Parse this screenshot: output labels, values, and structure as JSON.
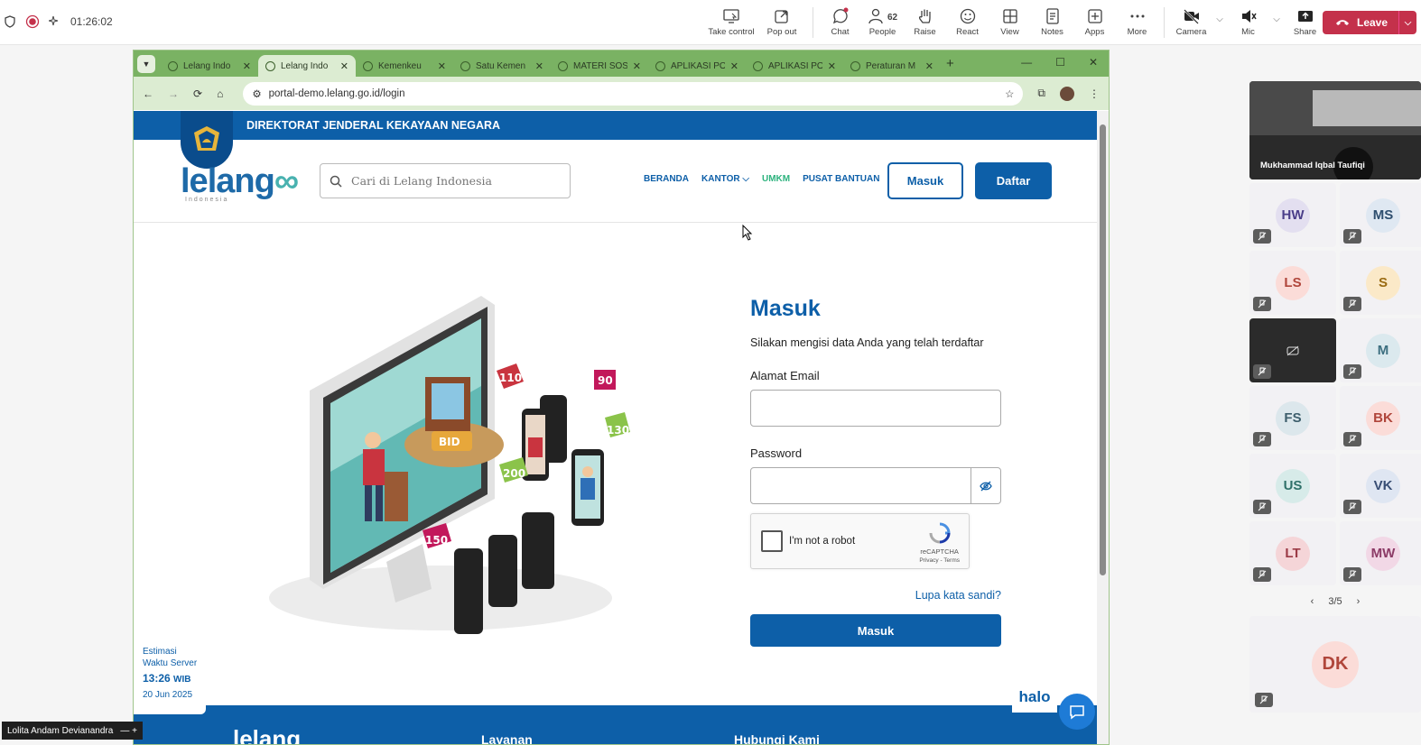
{
  "teams": {
    "timer": "01:26:02",
    "toolbar": [
      {
        "label": "Take control",
        "icon": "take-control-icon"
      },
      {
        "label": "Pop out",
        "icon": "pop-out-icon"
      },
      {
        "label": "Chat",
        "icon": "chat-icon"
      },
      {
        "label": "People",
        "icon": "people-icon",
        "count": "62"
      },
      {
        "label": "Raise",
        "icon": "raise-hand-icon"
      },
      {
        "label": "React",
        "icon": "react-icon"
      },
      {
        "label": "View",
        "icon": "view-icon"
      },
      {
        "label": "Notes",
        "icon": "notes-icon"
      },
      {
        "label": "Apps",
        "icon": "apps-icon"
      },
      {
        "label": "More",
        "icon": "more-icon"
      }
    ],
    "camera_label": "Camera",
    "mic_label": "Mic",
    "share_label": "Share",
    "leave_label": "Leave",
    "leave_color": "#c4314b",
    "presenter_name": "Lolita Andam Devianandra",
    "gallery": {
      "video_name": "Mukhammad Iqbal Taufiqi",
      "tiles": [
        {
          "initials": "HW",
          "bg": "#e3dff0",
          "fg": "#4b3f8a"
        },
        {
          "initials": "MS",
          "bg": "#dfe8f2",
          "fg": "#2f4f6f"
        },
        {
          "initials": "LS",
          "bg": "#fbdcd8",
          "fg": "#b0463b"
        },
        {
          "initials": "S",
          "bg": "#fbe9c8",
          "fg": "#9a6b12"
        },
        {
          "initials": "",
          "bg": "",
          "fg": "",
          "dark": true
        },
        {
          "initials": "M",
          "bg": "#dbe9ee",
          "fg": "#3d6f80"
        },
        {
          "initials": "FS",
          "bg": "#dce7ec",
          "fg": "#3d5e6c"
        },
        {
          "initials": "BK",
          "bg": "#fbdcd8",
          "fg": "#b0463b"
        },
        {
          "initials": "US",
          "bg": "#d7ebe9",
          "fg": "#2f7069"
        },
        {
          "initials": "VK",
          "bg": "#dfe6f2",
          "fg": "#394e74"
        },
        {
          "initials": "LT",
          "bg": "#f5d5d8",
          "fg": "#9b3a45"
        },
        {
          "initials": "MW",
          "bg": "#f2d8e6",
          "fg": "#8c3b66"
        }
      ],
      "page": "3/5",
      "spotlight_initials": "DK"
    }
  },
  "browser": {
    "tabs": [
      {
        "title": "Lelang Indo",
        "active": false
      },
      {
        "title": "Lelang Indo",
        "active": true
      },
      {
        "title": "Kemenkeu",
        "active": false
      },
      {
        "title": "Satu Kemen",
        "active": false
      },
      {
        "title": "MATERI SOS",
        "active": false
      },
      {
        "title": "APLIKASI PO",
        "active": false
      },
      {
        "title": "APLIKASI PO",
        "active": false
      },
      {
        "title": "Peraturan M",
        "active": false
      }
    ],
    "url": "portal-demo.lelang.go.id/login"
  },
  "site": {
    "ribbon": "DIREKTORAT JENDERAL KEKAYAAN NEGARA",
    "logo_main": "lelang",
    "logo_sub": "Indonesia",
    "search_placeholder": "Cari di Lelang Indonesia",
    "menu": {
      "beranda": "BERANDA",
      "kantor": "KANTOR",
      "umkm": "UMKM",
      "bantuan": "PUSAT BANTUAN"
    },
    "login_btn": "Masuk",
    "register_btn": "Daftar",
    "form": {
      "title": "Masuk",
      "subtitle": "Silakan mengisi data Anda yang telah terdaftar",
      "email_label": "Alamat Email",
      "password_label": "Password",
      "captcha_label": "I'm not a robot",
      "captcha_brand": "reCAPTCHA",
      "captcha_links": "Privacy - Terms",
      "forgot": "Lupa kata sandi?",
      "submit": "Masuk"
    },
    "illustration": {
      "bid_label": "BID",
      "bubbles": [
        "110",
        "90",
        "130",
        "200",
        "150"
      ]
    },
    "server": {
      "line1": "Estimasi",
      "line2": "Waktu Server",
      "time": "13:26",
      "zone": "WIB",
      "date": "20 Jun 2025"
    },
    "halo": "halo",
    "footer": {
      "logo": "lelang",
      "col1": "Layanan",
      "col2": "Hubungi Kami"
    },
    "brand_color": "#0d5fa8"
  }
}
